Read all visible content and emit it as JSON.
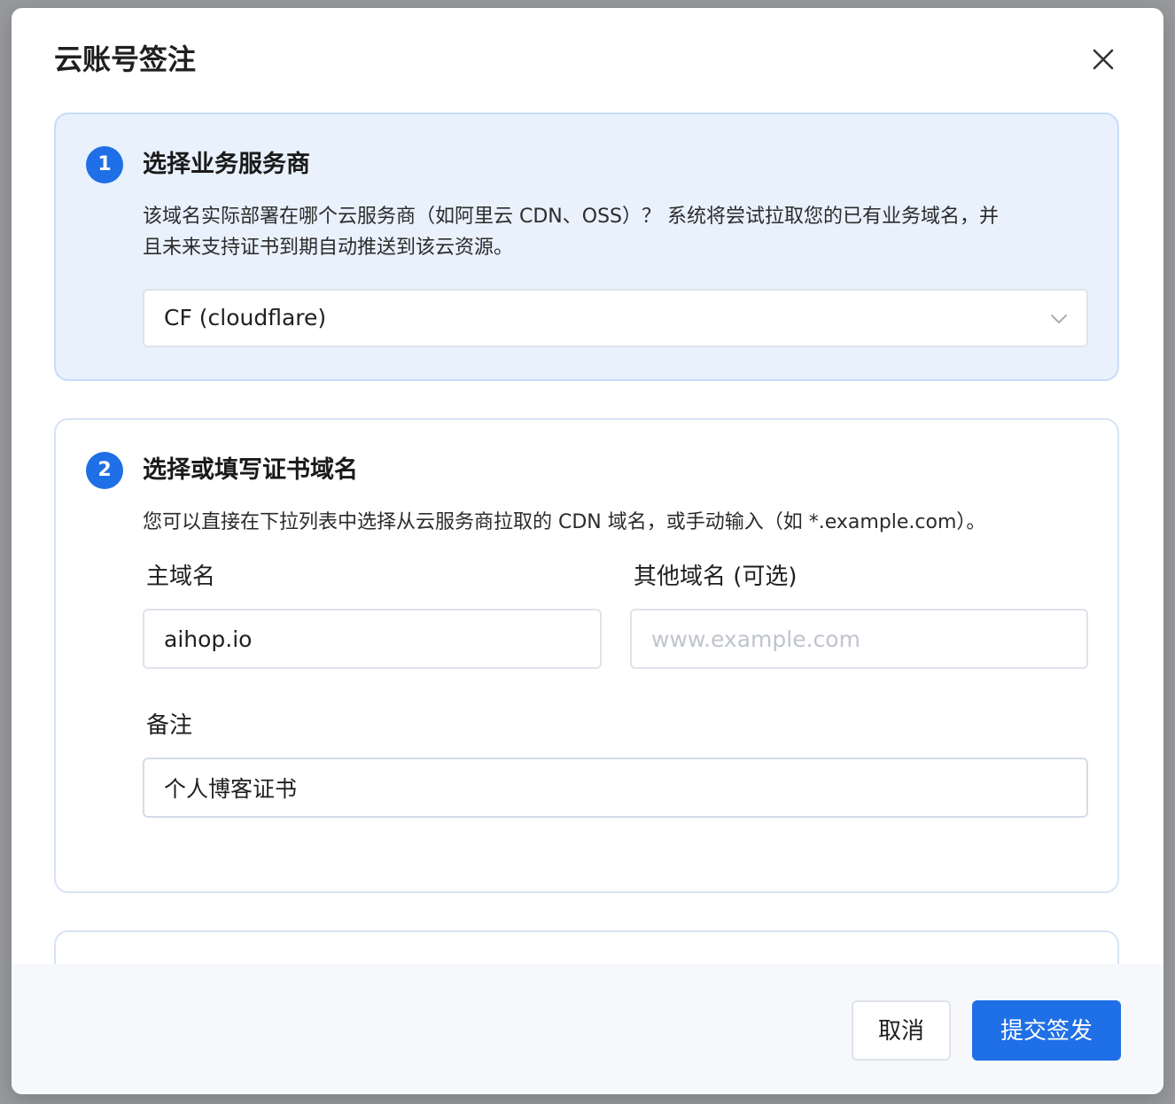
{
  "colors": {
    "accent": "#1f6fe6",
    "active_card_bg": "#e9f1fd",
    "footer_bg": "#f6f8fb"
  },
  "dialog": {
    "title": "云账号签注",
    "close_icon": "close-icon"
  },
  "step1": {
    "number": "1",
    "title": "选择业务服务商",
    "desc_line1": "该域名实际部署在哪个云服务商（如阿里云 CDN、OSS）？ 系统将尝试拉取您的已有业务域名，并",
    "desc_line2": "且未来支持证书到期自动推送到该云资源。",
    "provider_select": {
      "value": "CF (cloudflare)",
      "arrow_icon": "chevron-down-icon"
    }
  },
  "step2": {
    "number": "2",
    "title": "选择或填写证书域名",
    "desc": "您可以直接在下拉列表中选择从云服务商拉取的 CDN 域名，或手动输入（如 *.example.com）。",
    "primary_domain": {
      "label": "主域名",
      "value": "aihop.io"
    },
    "other_domains": {
      "label": "其他域名 (可选)",
      "value": "",
      "placeholder": "www.example.com"
    },
    "remark": {
      "label": "备注",
      "value": "个人博客证书"
    }
  },
  "footer": {
    "cancel_label": "取消",
    "submit_label": "提交签发"
  }
}
